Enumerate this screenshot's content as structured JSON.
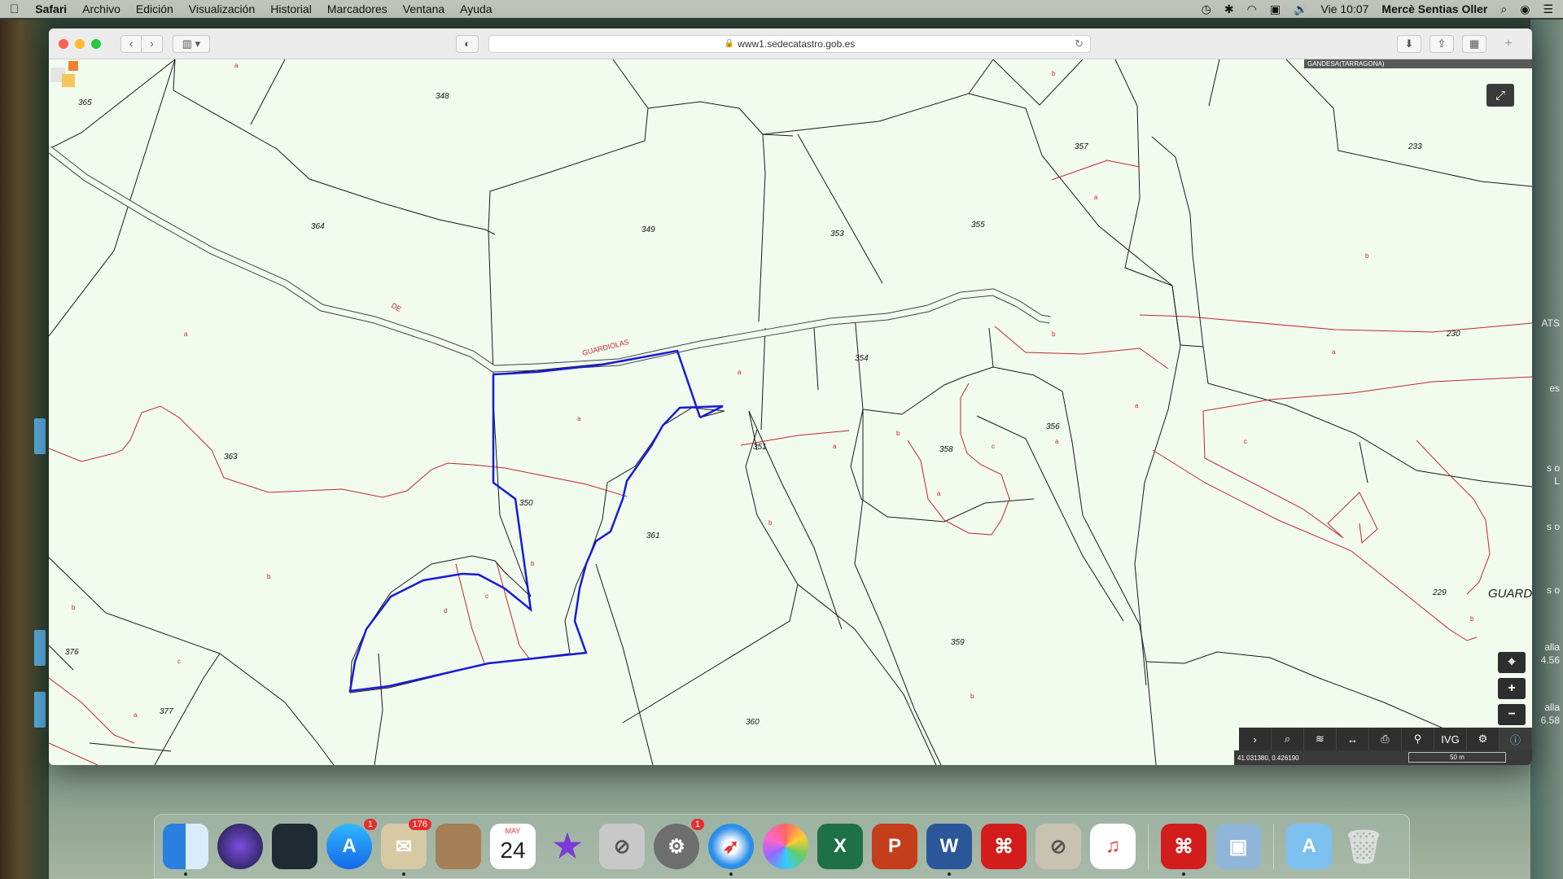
{
  "menubar": {
    "apple": "",
    "app_name": "Safari",
    "items": [
      "Archivo",
      "Edición",
      "Visualización",
      "Historial",
      "Marcadores",
      "Ventana",
      "Ayuda"
    ],
    "clock": "Vie 10:07",
    "user": "Mercè Sentias Oller"
  },
  "browser": {
    "url": "www1.sedecatastro.gob.es",
    "back_icon": "‹",
    "forward_icon": "›"
  },
  "map": {
    "region": "GANDESA(TARRAGONA)",
    "coords": "41.031380, 0.426190",
    "scale": "50 m",
    "street_words": [
      "DE",
      "GUARDIOLAS"
    ],
    "street_big": "GUARD",
    "parcel_labels": [
      "365",
      "348",
      "364",
      "349",
      "353",
      "355",
      "357",
      "233",
      "230",
      "354",
      "351",
      "356",
      "363",
      "350",
      "361",
      "358",
      "359",
      "229",
      "376",
      "377",
      "360"
    ],
    "sublabels": [
      "a",
      "b",
      "c",
      "d"
    ],
    "highlight_color": "#1a1ad6",
    "subparcel_line_color": "#c0282e"
  },
  "desktop_edge": {
    "texts": [
      "ATS",
      "es",
      "s o",
      "L",
      "s o",
      "s o",
      "alla",
      "4.56",
      "alla",
      "6.58"
    ]
  },
  "dock": {
    "calendar_month": "MAY",
    "calendar_day": "24",
    "badges": {
      "appstore": "1",
      "mail": "176",
      "settings": "1"
    },
    "excel_letter": "X",
    "ppt_letter": "P",
    "word_letter": "W"
  }
}
